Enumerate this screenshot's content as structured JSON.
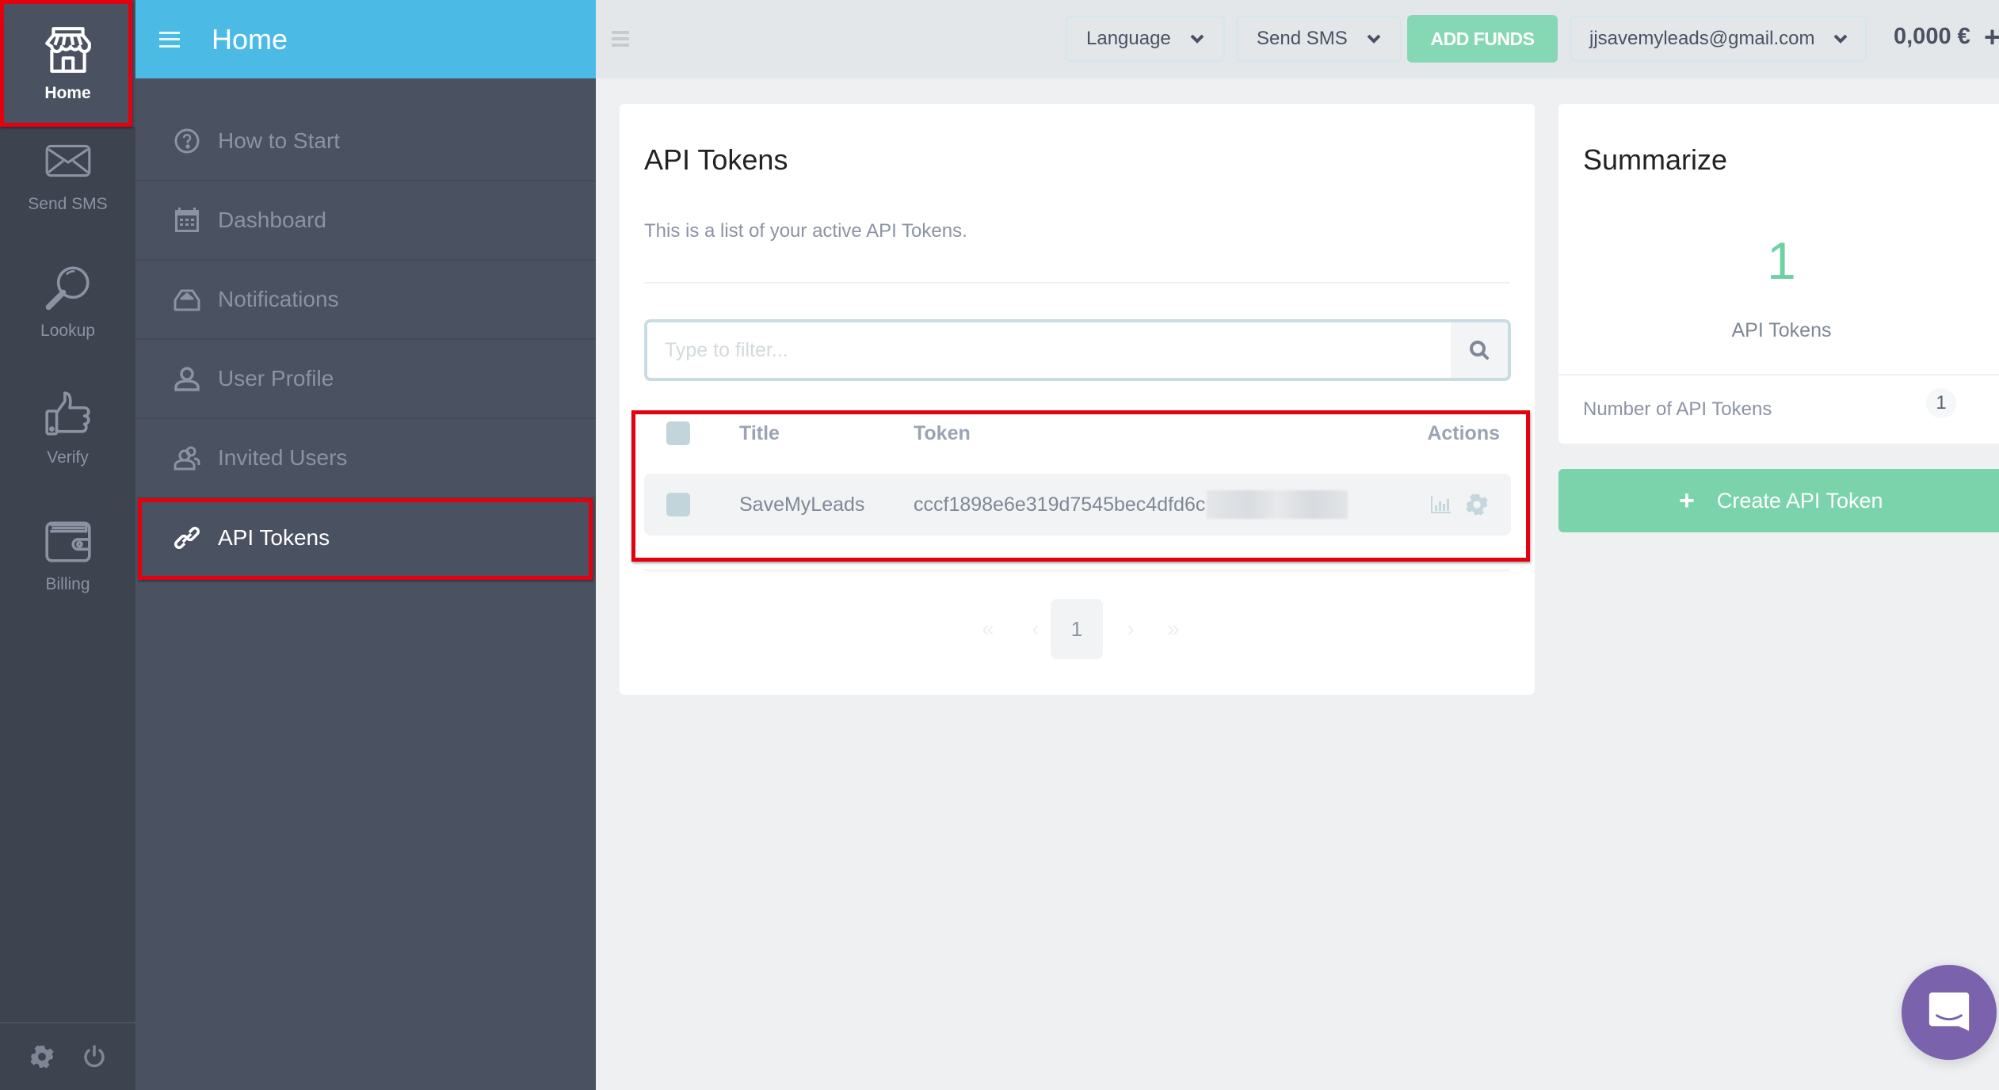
{
  "rail": {
    "items": [
      {
        "label": "Home",
        "icon": "store-icon",
        "active": true
      },
      {
        "label": "Send SMS",
        "icon": "envelope-icon"
      },
      {
        "label": "Lookup",
        "icon": "magnifier-icon"
      },
      {
        "label": "Verify",
        "icon": "thumbs-up-icon"
      },
      {
        "label": "Billing",
        "icon": "wallet-icon"
      }
    ],
    "footer": {
      "settings_icon": "gear-icon",
      "logout_icon": "power-icon"
    }
  },
  "sidebar": {
    "title": "Home",
    "items": [
      {
        "label": "How to Start",
        "icon": "question-circle-icon"
      },
      {
        "label": "Dashboard",
        "icon": "calendar-icon"
      },
      {
        "label": "Notifications",
        "icon": "inbox-icon"
      },
      {
        "label": "User Profile",
        "icon": "user-icon"
      },
      {
        "label": "Invited Users",
        "icon": "users-icon"
      },
      {
        "label": "API Tokens",
        "icon": "link-icon",
        "active": true
      }
    ]
  },
  "topbar": {
    "language_label": "Language",
    "send_sms_label": "Send SMS",
    "add_funds_label": "ADD FUNDS",
    "account_email": "jjsavemyleads@gmail.com",
    "balance": "0,000 €",
    "plus_label": "+"
  },
  "main": {
    "title": "API Tokens",
    "description": "This is a list of your active API Tokens.",
    "filter": {
      "placeholder": "Type to filter...",
      "value": ""
    },
    "table": {
      "headers": {
        "title": "Title",
        "token": "Token",
        "actions": "Actions"
      },
      "rows": [
        {
          "title": "SaveMyLeads",
          "token_visible": "cccf1898e6e319d7545bec4dfd6c",
          "token_redacted": true
        }
      ]
    },
    "pagination": {
      "first": "«",
      "prev": "‹",
      "current": "1",
      "next": "›",
      "last": "»"
    }
  },
  "summary": {
    "title": "Summarize",
    "count": "1",
    "count_label": "API Tokens",
    "row_label": "Number of API Tokens",
    "row_value": "1",
    "create_label": "Create API Token",
    "create_icon": "+"
  },
  "colors": {
    "accent_blue": "#4bbbe6",
    "accent_green": "#7bd3ac",
    "rail_bg": "#3e4350",
    "sidebar_bg": "#4a5160",
    "highlight_red": "#e3000f",
    "chat_purple": "#7a62ad"
  }
}
